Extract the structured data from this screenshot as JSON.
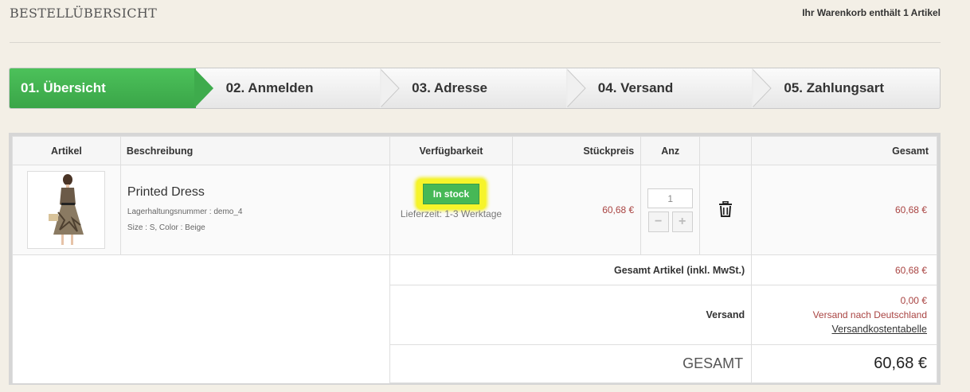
{
  "header": {
    "title": "BESTELLÜBERSICHT",
    "cart_info": "Ihr Warenkorb enthält 1 Artikel"
  },
  "steps": [
    {
      "label": "01. Übersicht",
      "active": true
    },
    {
      "label": "02. Anmelden",
      "active": false
    },
    {
      "label": "03. Adresse",
      "active": false
    },
    {
      "label": "04. Versand",
      "active": false
    },
    {
      "label": "05. Zahlungsart",
      "active": false
    }
  ],
  "table": {
    "headers": {
      "article": "Artikel",
      "description": "Beschreibung",
      "availability": "Verfügbarkeit",
      "unit_price": "Stückpreis",
      "quantity": "Anz",
      "total": "Gesamt"
    },
    "product": {
      "name": "Printed Dress",
      "sku": "Lagerhaltungsnummer : demo_4",
      "attributes": "Size : S, Color : Beige",
      "stock": "In stock",
      "delivery": "Lieferzeit: 1-3 Werktage",
      "unit_price": "60,68 €",
      "quantity": "1",
      "minus": "−",
      "plus": "+",
      "total": "60,68 €"
    }
  },
  "summary": {
    "items_label": "Gesamt Artikel (inkl. MwSt.)",
    "items_value": "60,68 €",
    "shipping_label": "Versand",
    "shipping_value": "0,00 €",
    "shipping_note": "Versand nach Deutschland",
    "shipping_link": "Versandkostentabelle",
    "grand_label": "GESAMT",
    "grand_value": "60,68 €"
  },
  "colors": {
    "accent_green": "#3aa548",
    "price_red": "#a94442",
    "highlight_yellow": "#f6f42a"
  }
}
